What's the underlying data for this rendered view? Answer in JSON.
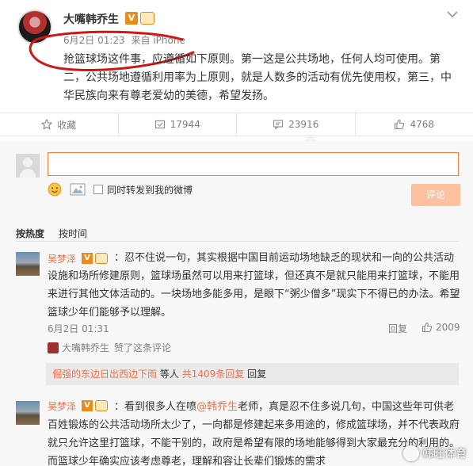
{
  "post": {
    "author": "大嘴韩乔生",
    "v_badge": "V",
    "date": "6月2日 01:23",
    "source": "来自 iPhone",
    "text": "抢篮球场这件事，应遵循如下原则。第一这是公共场地，任何人均可使用。第二，公共场地遵循利用率为上原则，就是人数多的活动有优先使用权，第三，中华民族向来有尊老爱幼的美德，希望发扬。"
  },
  "actions": {
    "favorite": "收藏",
    "repost": "17944",
    "comment": "23916",
    "like": "4768"
  },
  "composer": {
    "placeholder": "",
    "repost_label": "同时转发到我的微博",
    "submit_label": "评论"
  },
  "sort_tabs": {
    "hot": "按热度",
    "time": "按时间"
  },
  "comments": [
    {
      "author": "吴梦泽",
      "text": "：忍不住说一句，其实根据中国目前运动场地缺乏的现状和一向的公共活动设施和场所修建原则，篮球场虽然可以用来打篮球，但还真不是就只能用来打篮球，不能用来进行其他文体活动的。一块场地多能多用，是眼下“粥少僧多”现实下不得已的办法。希望篮球少年们能够予以理解。",
      "time": "6月2日 01:31",
      "reply_label": "回复",
      "likes": "2009",
      "liked_by": "大嘴韩乔生",
      "liked_suffix": "赞了这条评论",
      "replies_link": "倔强的东边日出西边下雨",
      "replies_mid": "等人",
      "replies_count": "共1409条回复"
    },
    {
      "author": "吴梦泽",
      "text_prefix": "：看到很多人在喷",
      "mention": "@韩乔生",
      "text_suffix": "老师，真是忍不住多说几句，中国这些年可供老百姓锻炼的公共活动场所太少了，一向都是修建起来多用途的，修成篮球场，并不代表政府就只允许这里打篮球，不能干别的，政府是希望有限的场地能够得到大家最充分的利用的。而篮球少年确实应该考虑尊老，理解和容让长辈们锻炼的需求"
    }
  ],
  "watermark": "韩旺体育",
  "colors": {
    "accent": "#eb7350",
    "input_border": "#fa7d3c",
    "submit_bg": "#ffc09f",
    "annotation_red": "#d01515"
  }
}
